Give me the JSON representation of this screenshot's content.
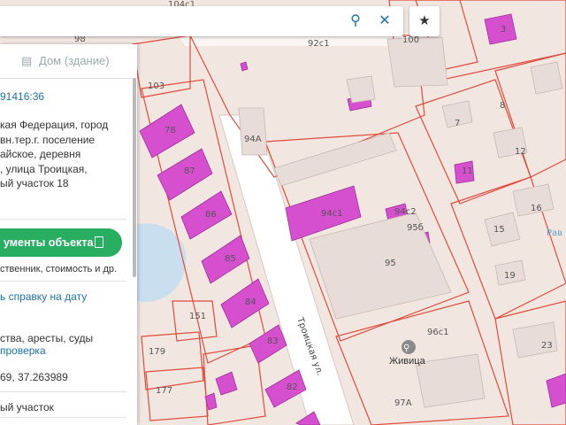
{
  "search": {
    "value": "",
    "search_icon": "search-icon",
    "clear_icon": "close-icon"
  },
  "favorite": {
    "icon": "star-icon"
  },
  "panel": {
    "tab_label": "Дом (здание)",
    "tab_icon": "building-icon",
    "cadastral_number": "91416:36",
    "address_lines": [
      "кая Федерация, город",
      "вн.тер.г. поселение",
      "айское, деревня",
      ", улица Троицкая,",
      "ый участок 18"
    ],
    "docs_button": "ументы объекта",
    "docs_subtitle": "ственник, стоимость и др.",
    "report_link": "ь справку на дату",
    "restrictions_text": "ства, аресты, суды",
    "check_link": "проверка",
    "coordinates": "69, 37.263989",
    "land_type": "ый участок"
  },
  "map": {
    "parcel_labels": [
      "104с1",
      "98",
      "103",
      "78",
      "87",
      "86",
      "85",
      "84",
      "83",
      "82",
      "151",
      "179",
      "177",
      "92с1",
      "100",
      "94А",
      "94с1",
      "94с2",
      "95б",
      "95",
      "96с1",
      "97А",
      "3",
      "7",
      "8",
      "12",
      "11",
      "15",
      "16",
      "19",
      "23",
      "Рав"
    ],
    "street_name": "Троицкая ул.",
    "poi_name": "Живица",
    "colors": {
      "building": "#d64fcf",
      "parcel_border": "#e04c3c",
      "road": "#ffffff",
      "water": "#c9dff0",
      "background": "#f2e6e1"
    }
  }
}
